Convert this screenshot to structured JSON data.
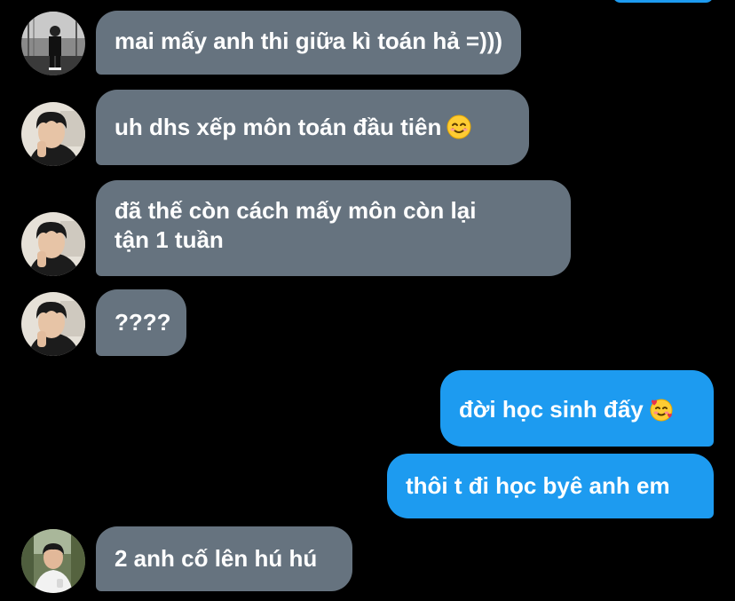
{
  "conversation": {
    "messages": [
      {
        "sender": "other",
        "avatar": "user-photo-bw",
        "text": "mai mấy anh thi giữa kì toán hả =)))"
      },
      {
        "sender": "other",
        "avatar": "user-photo-dark-hair",
        "text": "uh dhs xếp môn toán đầu tiên",
        "emoji": "smiling-face-icon"
      },
      {
        "sender": "other",
        "avatar": "user-photo-dark-hair",
        "lines": [
          "đã thế còn cách mấy môn còn lại",
          "tận 1 tuần"
        ]
      },
      {
        "sender": "other",
        "avatar": "user-photo-dark-hair",
        "text": "????"
      },
      {
        "sender": "me",
        "text": "đời học sinh đấy",
        "emoji": "smiling-face-with-hearts-icon"
      },
      {
        "sender": "me",
        "text": "thôi t đi học byê anh em"
      },
      {
        "sender": "other",
        "avatar": "user-photo-outdoor",
        "text": "2 anh cố lên hú hú"
      }
    ]
  },
  "colors": {
    "background": "#000000",
    "incoming_bubble": "#66737f",
    "outgoing_bubble": "#1d9bf0",
    "text": "#ffffff"
  }
}
